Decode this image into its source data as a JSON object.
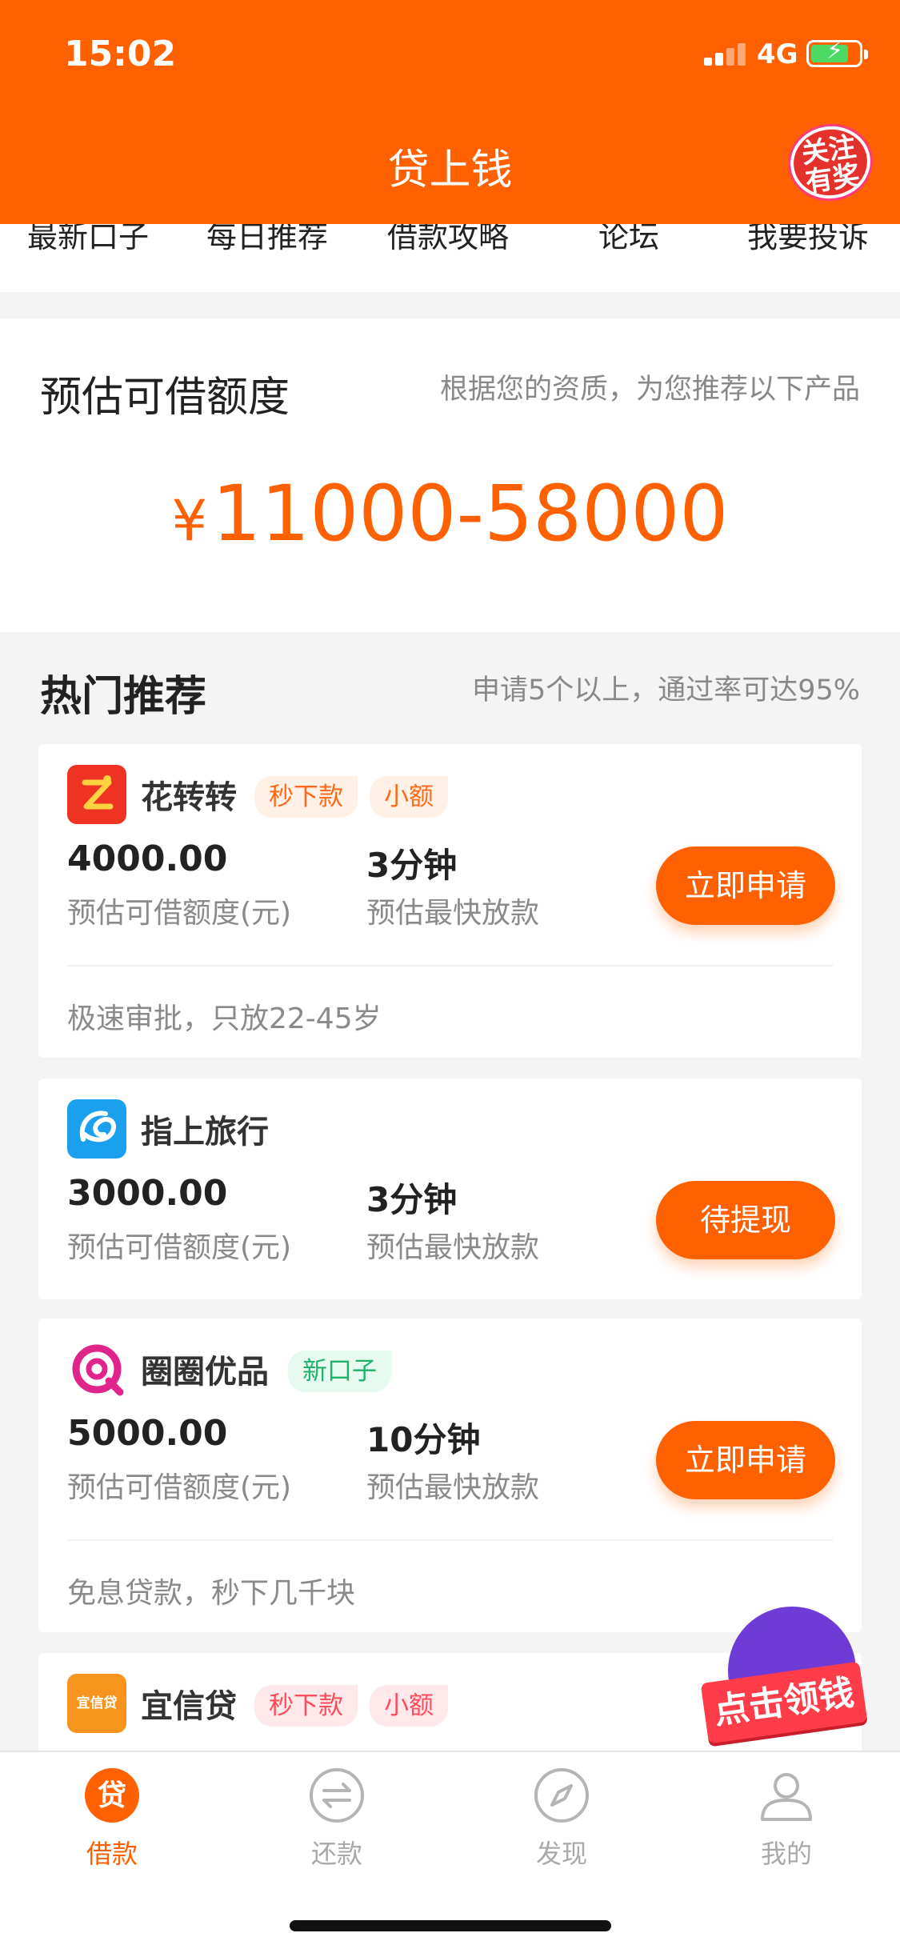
{
  "status_bar": {
    "time": "15:02",
    "network": "4G"
  },
  "header": {
    "title": "贷上钱",
    "badge_text": "关注有奖"
  },
  "nav": {
    "items": [
      "最新口子",
      "每日推荐",
      "借款攻略",
      "论坛",
      "我要投诉"
    ]
  },
  "estimate": {
    "title": "预估可借额度",
    "hint": "根据您的资质，为您推荐以下产品",
    "currency": "¥",
    "amount": "11000-58000"
  },
  "hot": {
    "title": "热门推荐",
    "hint": "申请5个以上，通过率可达95%",
    "limit_label": "预估可借额度(元)",
    "speed_label": "预估最快放款",
    "products": [
      {
        "name": "花转转",
        "tags": [
          "秒下款",
          "小额"
        ],
        "limit": "4000.00",
        "speed": "3分钟",
        "button": "立即申请",
        "note": "极速审批，只放22-45岁"
      },
      {
        "name": "指上旅行",
        "tags": [],
        "limit": "3000.00",
        "speed": "3分钟",
        "button": "待提现",
        "note": ""
      },
      {
        "name": "圈圈优品",
        "tags": [
          "新口子"
        ],
        "limit": "5000.00",
        "speed": "10分钟",
        "button": "立即申请",
        "note": "免息贷款，秒下几千块"
      },
      {
        "name": "宜信贷",
        "tags": [
          "秒下款",
          "小额"
        ],
        "logo_text": "宜信贷"
      }
    ]
  },
  "promo": {
    "label": "点击领钱"
  },
  "tabbar": {
    "items": [
      {
        "label": "借款",
        "icon": "loan-icon",
        "active": true
      },
      {
        "label": "还款",
        "icon": "repay-icon",
        "active": false
      },
      {
        "label": "发现",
        "icon": "compass-icon",
        "active": false
      },
      {
        "label": "我的",
        "icon": "user-icon",
        "active": false
      }
    ]
  },
  "colors": {
    "brand": "#ff6100",
    "tag_orange": "#ff6a1a",
    "tag_green": "#21b26a",
    "tag_pink": "#ff4b5c"
  }
}
